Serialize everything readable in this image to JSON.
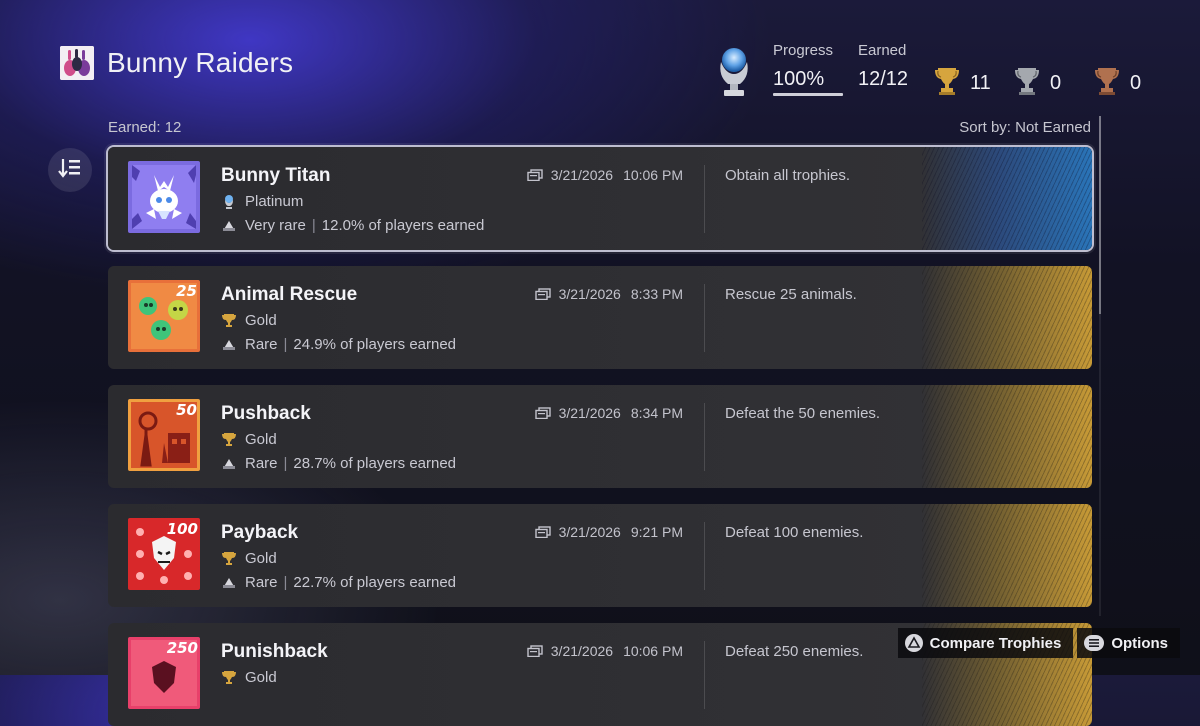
{
  "game": {
    "title": "Bunny Raiders",
    "icon": "bunny-raiders-game-icon"
  },
  "stats": {
    "progress_label": "Progress",
    "progress_value": "100%",
    "progress_fraction": 1.0,
    "earned_label": "Earned",
    "earned_value": "12/12",
    "gold_count": "11",
    "silver_count": "0",
    "bronze_count": "0"
  },
  "list_header": {
    "earned": "Earned: 12",
    "sort_by": "Sort by: Not Earned"
  },
  "trophies": [
    {
      "name": "Bunny Titan",
      "grade": "Platinum",
      "rarity": "Very rare",
      "percent": "12.0% of players earned",
      "date": "3/21/2026",
      "time": "10:06 PM",
      "description": "Obtain all trophies.",
      "art": "bunny-titan-art",
      "art_badge": ""
    },
    {
      "name": "Animal Rescue",
      "grade": "Gold",
      "rarity": "Rare",
      "percent": "24.9% of players earned",
      "date": "3/21/2026",
      "time": "8:33 PM",
      "description": "Rescue 25 animals.",
      "art": "animal-rescue-art",
      "art_badge": "25"
    },
    {
      "name": "Pushback",
      "grade": "Gold",
      "rarity": "Rare",
      "percent": "28.7% of players earned",
      "date": "3/21/2026",
      "time": "8:34 PM",
      "description": "Defeat the 50 enemies.",
      "art": "pushback-art",
      "art_badge": "50"
    },
    {
      "name": "Payback",
      "grade": "Gold",
      "rarity": "Rare",
      "percent": "22.7% of players earned",
      "date": "3/21/2026",
      "time": "9:21 PM",
      "description": "Defeat 100 enemies.",
      "art": "payback-art",
      "art_badge": "100"
    },
    {
      "name": "Punishback",
      "grade": "Gold",
      "rarity": "",
      "percent": "",
      "date": "3/21/2026",
      "time": "10:06 PM",
      "description": "Defeat 250 enemies.",
      "art": "punishback-art",
      "art_badge": "250"
    }
  ],
  "footer": {
    "compare_label": "Compare Trophies",
    "options_label": "Options"
  },
  "colors": {
    "gold": "#c79a36",
    "platinum": "#2a74b8",
    "silver": "#9aa0a6",
    "bronze": "#a86a4a"
  },
  "icons": {
    "platinum_trophy": "platinum-trophy-icon",
    "gold_trophy": "gold-trophy-icon",
    "silver_trophy": "silver-trophy-icon",
    "bronze_trophy": "bronze-trophy-icon",
    "sort": "sort-icon",
    "rarity": "rarity-pyramid-icon",
    "date": "earned-date-icon",
    "triangle_button": "triangle-button-icon",
    "options_button": "options-button-icon"
  }
}
